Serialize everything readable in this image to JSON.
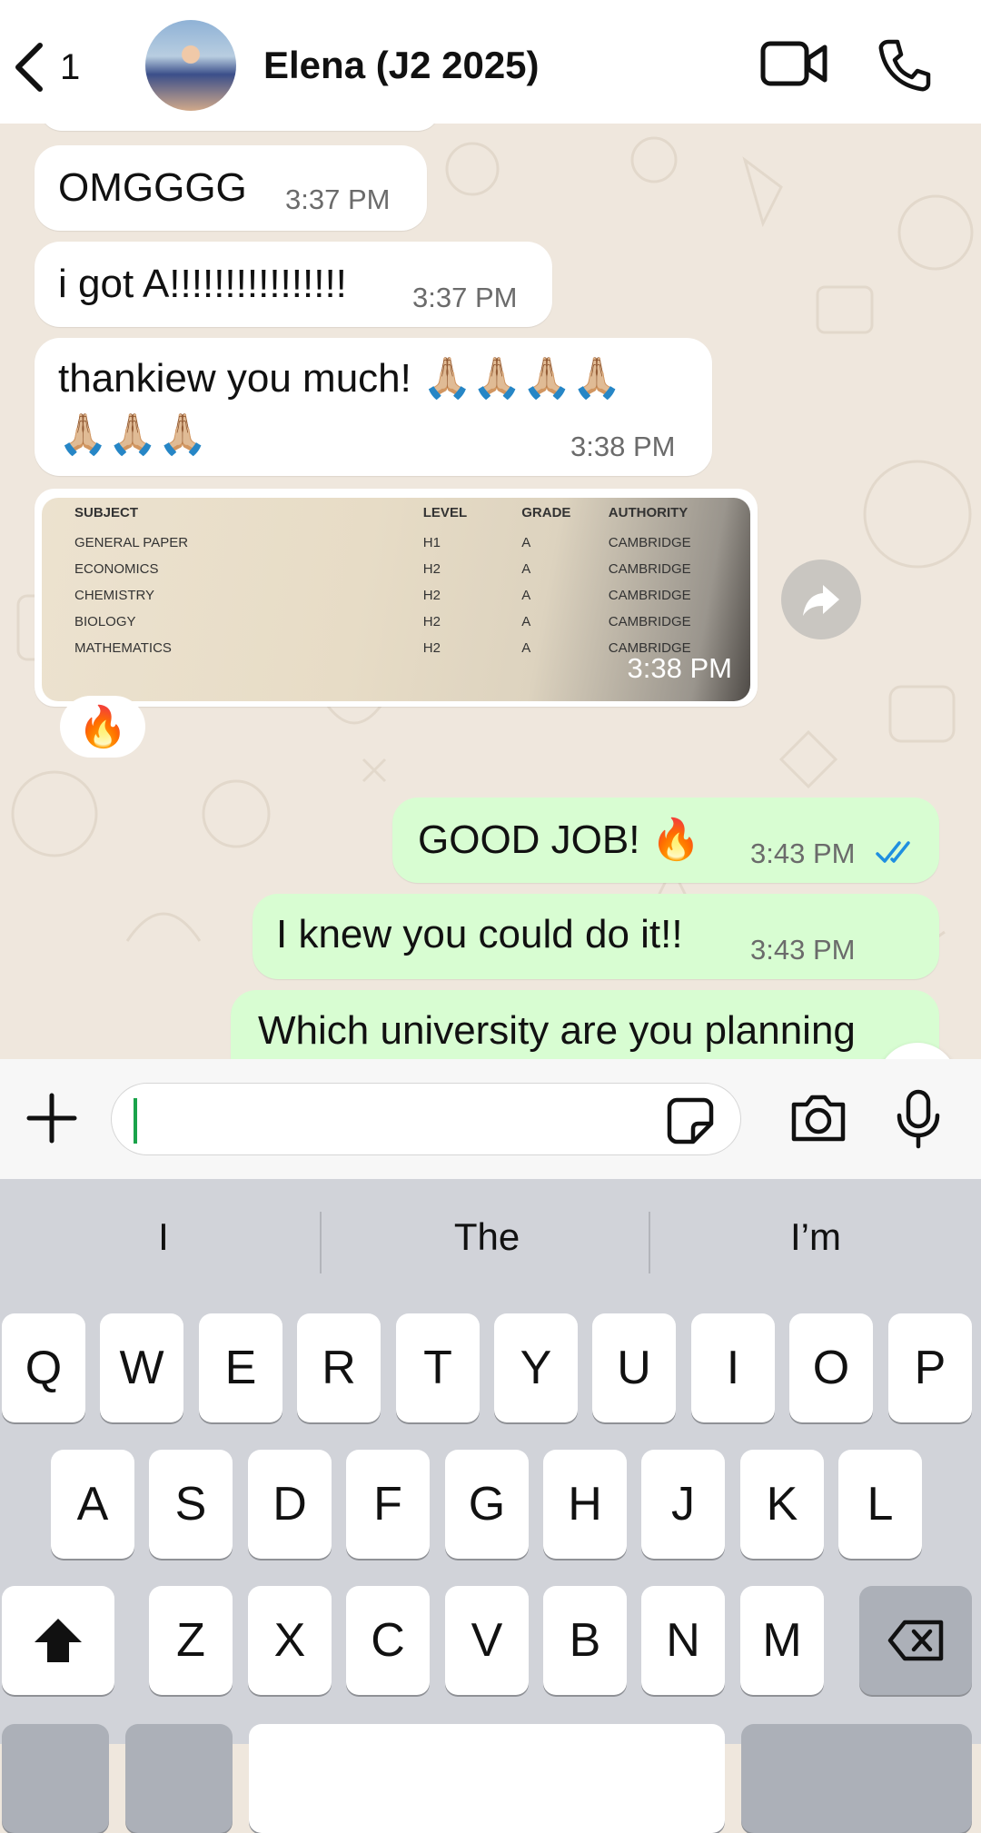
{
  "header": {
    "back_count": "1",
    "contact_name": "Elena (J2 2025)",
    "icons": [
      "chevron-left-icon",
      "video-camera-icon",
      "phone-icon"
    ]
  },
  "messages": [
    {
      "direction": "incoming",
      "text": "OMGGGG",
      "time": "3:37 PM"
    },
    {
      "direction": "incoming",
      "text": "i got A!!!!!!!!!!!!!!!!",
      "time": "3:37 PM"
    },
    {
      "direction": "incoming",
      "text_line1": "thankiew you much! 🙏🏼🙏🏼🙏🏼🙏🏼",
      "text_line2": "🙏🏼🙏🏼🙏🏼",
      "time": "3:38 PM"
    },
    {
      "direction": "incoming",
      "type": "photo",
      "time": "3:38 PM",
      "reaction": "🔥",
      "table": {
        "headers": [
          "SUBJECT",
          "LEVEL",
          "GRADE",
          "AUTHORITY"
        ],
        "rows": [
          [
            "GENERAL PAPER",
            "H1",
            "A",
            "CAMBRIDGE"
          ],
          [
            "ECONOMICS",
            "H2",
            "A",
            "CAMBRIDGE"
          ],
          [
            "CHEMISTRY",
            "H2",
            "A",
            "CAMBRIDGE"
          ],
          [
            "BIOLOGY",
            "H2",
            "A",
            "CAMBRIDGE"
          ],
          [
            "MATHEMATICS",
            "H2",
            "A",
            "CAMBRIDGE"
          ]
        ]
      }
    },
    {
      "direction": "outgoing",
      "text": "GOOD JOB! 🔥",
      "time": "3:43 PM",
      "status": "read"
    },
    {
      "direction": "outgoing",
      "text": "I knew you could do it!!",
      "time": "3:43 PM"
    },
    {
      "direction": "outgoing",
      "text": "Which university are you planning"
    }
  ],
  "input": {
    "placeholder": "",
    "value": ""
  },
  "keyboard": {
    "suggestions": [
      "I",
      "The",
      "I’m"
    ],
    "row1": [
      "Q",
      "W",
      "E",
      "R",
      "T",
      "Y",
      "U",
      "I",
      "O",
      "P"
    ],
    "row2": [
      "A",
      "S",
      "D",
      "F",
      "G",
      "H",
      "J",
      "K",
      "L"
    ],
    "row3": [
      "Z",
      "X",
      "C",
      "V",
      "B",
      "N",
      "M"
    ]
  },
  "colors": {
    "outgoing_bubble": "#d8fdd2",
    "incoming_bubble": "#ffffff",
    "read_ticks": "#1f8fe0",
    "caret": "#1aa34a"
  }
}
